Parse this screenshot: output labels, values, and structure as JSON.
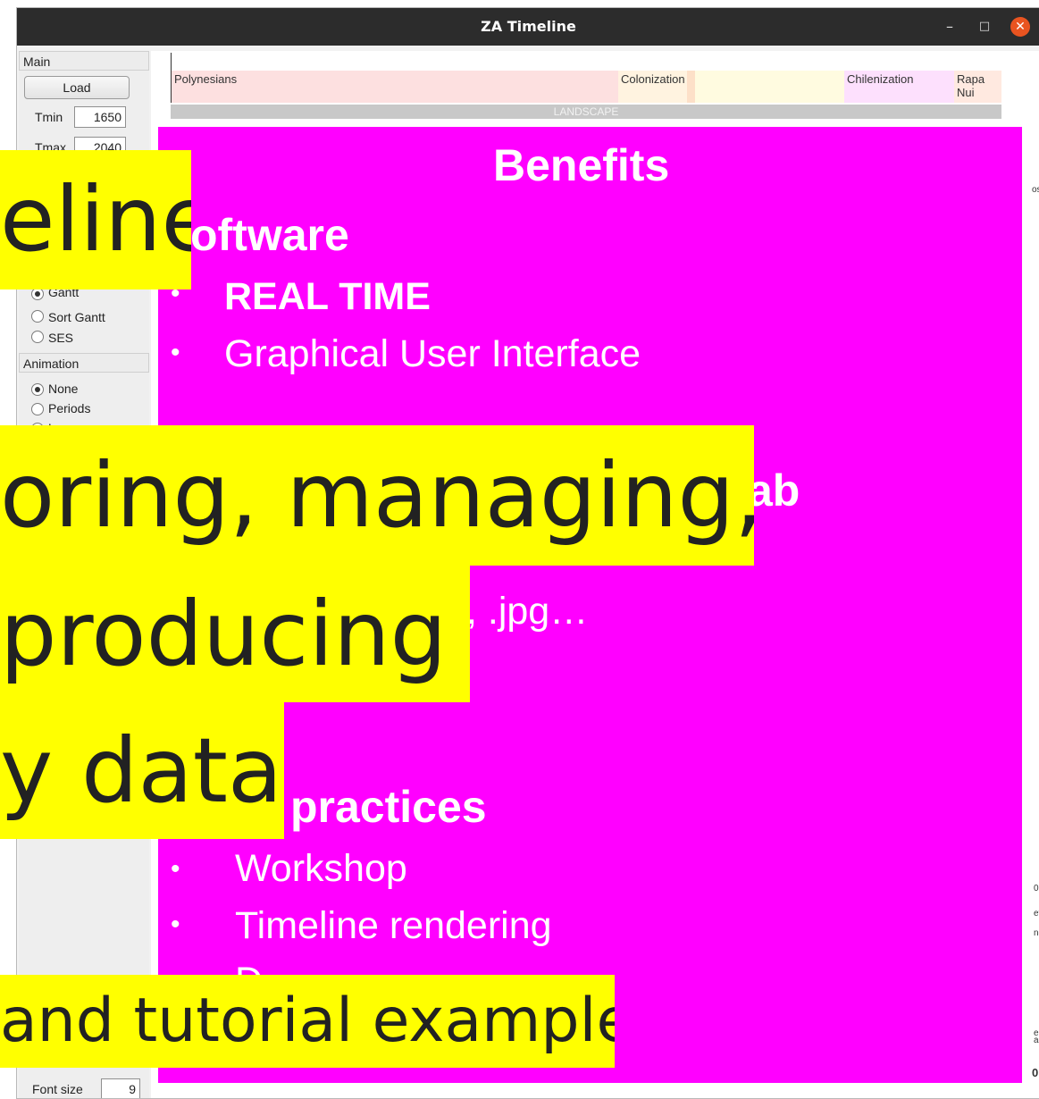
{
  "window": {
    "title": "ZA Timeline",
    "controls": {
      "minimize": "–",
      "maximize": "□",
      "close": "✕"
    }
  },
  "panel": {
    "main_label": "Main",
    "load_button": "Load",
    "tmin_label": "Tmin",
    "tmin_value": "1650",
    "tmax_label": "Tmax",
    "tmax_value": "2040",
    "view_options": [
      "Gantt",
      "Sort Gantt",
      "SES"
    ],
    "animation_label": "Animation",
    "animation_options": [
      "None",
      "Periods",
      "Layers"
    ],
    "animation_selected": "None",
    "font_size_label": "Font size",
    "font_size_value": "9"
  },
  "timeline": {
    "periods": [
      "Polynesians",
      "Colonization",
      "Chilenization",
      "Rapa Nui"
    ],
    "layer_label": "LANDSCAPE",
    "edge_fragments": [
      "os",
      "0",
      "et",
      "nc",
      "e",
      "ag",
      "0"
    ]
  },
  "slide": {
    "title": "Benefits",
    "section_software": "Software",
    "section_software_visible": "oftware",
    "software_items": [
      "REAL TIME",
      "Graphical User Interface"
    ],
    "partial_matlab": "ab",
    "partial_formats": ", .jpg…",
    "section_practices": "practices",
    "practice_items": [
      "Workshop",
      "Timeline rendering"
    ],
    "partial_bottom": "D"
  },
  "captions": {
    "line1": "eline",
    "line2": "oring, managing,",
    "line3": "producing",
    "line4": "y data",
    "line5": "and tutorial example"
  },
  "colors": {
    "slide_background": "#ff00ff",
    "caption_highlight": "#ffff00",
    "titlebar": "#2c2c2c",
    "close_button": "#e95420",
    "period_polynesians": "#fde0e0",
    "period_colonization": "#fff3e0",
    "period_colonization_gap": "#fde0c8",
    "period_chilenization": "#fde0fd",
    "period_rapanui": "#ffe9e0",
    "period_yellow": "#fffbe0"
  }
}
